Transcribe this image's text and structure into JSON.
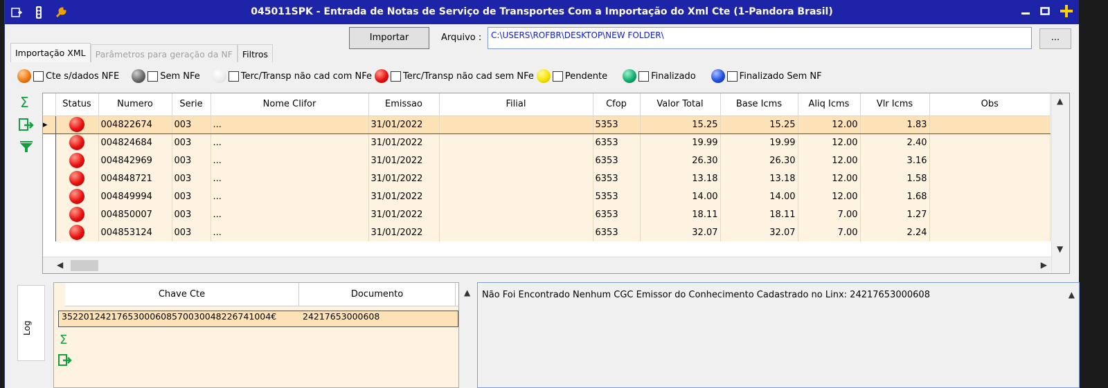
{
  "window": {
    "title": "045011SPK - Entrada de Notas de Serviço de Transportes Com a Importação do Xml Cte (1-Pandora Brasil)"
  },
  "toolbar": {
    "import_label": "Importar",
    "arquivo_label": "Arquivo :",
    "arquivo_value": "C:\\USERS\\ROFBR\\DESKTOP\\NEW FOLDER\\",
    "browse_label": "..."
  },
  "tabs": [
    {
      "label": "Importação XML",
      "state": "active"
    },
    {
      "label": "Parâmetros para geração da NF",
      "state": "disabled"
    },
    {
      "label": "Filtros",
      "state": "normal"
    }
  ],
  "legend": [
    {
      "label": "Cte s/dados NFE",
      "color": "#f07a10"
    },
    {
      "label": "Sem NFe",
      "color": "#6a6a6a"
    },
    {
      "label": "Terc/Transp não cad com NFe",
      "color": "#e8e8e8"
    },
    {
      "label": "Terc/Transp não cad sem NFe",
      "color": "#e81010"
    },
    {
      "label": "Pendente",
      "color": "#f5e400"
    },
    {
      "label": "Finalizado",
      "color": "#10b070"
    },
    {
      "label": "Finalizado Sem NF",
      "color": "#2050e0"
    }
  ],
  "grid": {
    "columns": [
      "Status",
      "Numero",
      "Serie",
      "Nome Clifor",
      "Emissao",
      "Filial",
      "Cfop",
      "Valor Total",
      "Base Icms",
      "Aliq Icms",
      "Vlr Icms",
      "Obs"
    ],
    "rows": [
      {
        "numero": "004822674",
        "serie": "003",
        "nome": "...",
        "emissao": "31/01/2022",
        "filial": "",
        "cfop": "5353",
        "valor": "15.25",
        "base": "15.25",
        "aliq": "12.00",
        "vlr": "1.83",
        "obs": ""
      },
      {
        "numero": "004824684",
        "serie": "003",
        "nome": "...",
        "emissao": "31/01/2022",
        "filial": "",
        "cfop": "6353",
        "valor": "19.99",
        "base": "19.99",
        "aliq": "12.00",
        "vlr": "2.40",
        "obs": ""
      },
      {
        "numero": "004842969",
        "serie": "003",
        "nome": "...",
        "emissao": "31/01/2022",
        "filial": "",
        "cfop": "6353",
        "valor": "26.30",
        "base": "26.30",
        "aliq": "12.00",
        "vlr": "3.16",
        "obs": ""
      },
      {
        "numero": "004848721",
        "serie": "003",
        "nome": "...",
        "emissao": "31/01/2022",
        "filial": "",
        "cfop": "6353",
        "valor": "13.18",
        "base": "13.18",
        "aliq": "12.00",
        "vlr": "1.58",
        "obs": ""
      },
      {
        "numero": "004849994",
        "serie": "003",
        "nome": "...",
        "emissao": "31/01/2022",
        "filial": "",
        "cfop": "5353",
        "valor": "14.00",
        "base": "14.00",
        "aliq": "12.00",
        "vlr": "1.68",
        "obs": ""
      },
      {
        "numero": "004850007",
        "serie": "003",
        "nome": "...",
        "emissao": "31/01/2022",
        "filial": "",
        "cfop": "6353",
        "valor": "18.11",
        "base": "18.11",
        "aliq": "7.00",
        "vlr": "1.27",
        "obs": ""
      },
      {
        "numero": "004853124",
        "serie": "003",
        "nome": "...",
        "emissao": "31/01/2022",
        "filial": "",
        "cfop": "6353",
        "valor": "32.07",
        "base": "32.07",
        "aliq": "7.00",
        "vlr": "2.24",
        "obs": ""
      }
    ]
  },
  "log": {
    "tab_label": "Log",
    "columns": [
      "Chave Cte",
      "Documento"
    ],
    "row": {
      "chave": "35220124217653000608570030048226741004€",
      "documento": "24217653000608"
    },
    "message": "Não Foi Encontrado Nenhum CGC Emissor do Conhecimento Cadastrado no Linx: 24217653000608"
  }
}
